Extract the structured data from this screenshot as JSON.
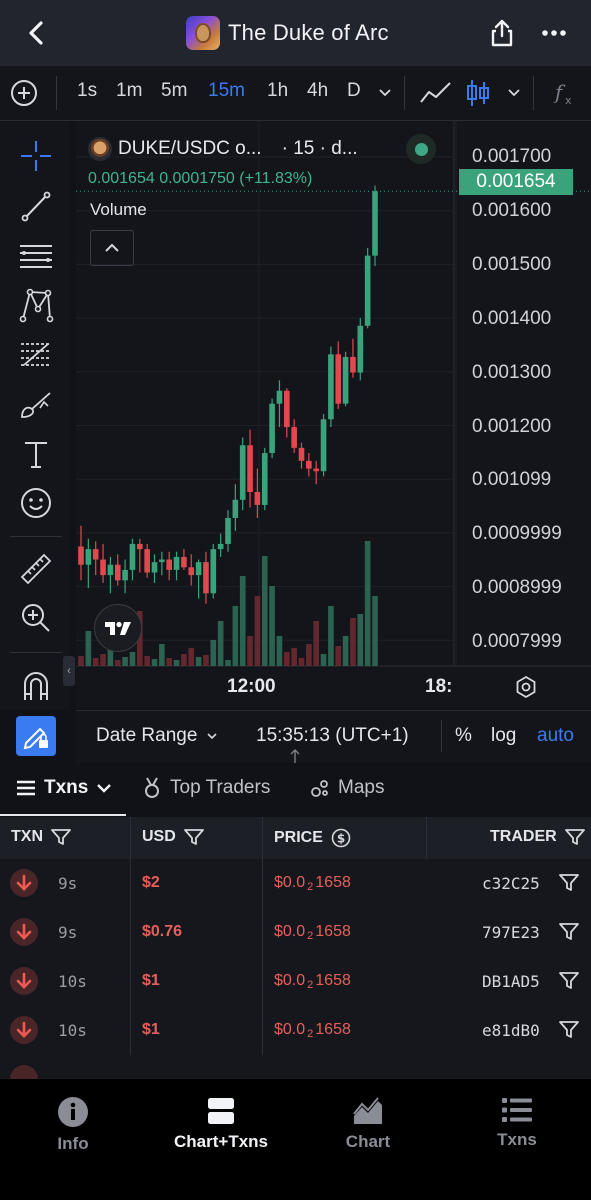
{
  "header": {
    "title": "The Duke of Arc"
  },
  "timeframes": [
    {
      "label": "1s",
      "active": false
    },
    {
      "label": "1m",
      "active": false
    },
    {
      "label": "5m",
      "active": false
    },
    {
      "label": "15m",
      "active": true
    },
    {
      "label": "1h",
      "active": false
    },
    {
      "label": "4h",
      "active": false
    },
    {
      "label": "D",
      "active": false
    }
  ],
  "chart": {
    "pair_label": "DUKE/USDC o...",
    "interval_label": "· 15 · d...",
    "ohlc": {
      "price": "0.001654",
      "change": "0.0001750",
      "change_pct": "(+11.83%)"
    },
    "volume_label": "Volume",
    "current_price": "0.001654",
    "y_ticks": [
      "0.001700",
      "0.001600",
      "0.001500",
      "0.001400",
      "0.001300",
      "0.001200",
      "0.001099",
      "0.0009999",
      "0.0008999",
      "0.0007999"
    ],
    "x_ticks": [
      "12:00",
      "18:"
    ],
    "bottom": {
      "date_range": "Date Range",
      "clock": "15:35:13 (UTC+1)",
      "pct": "%",
      "log": "log",
      "auto": "auto"
    }
  },
  "chart_data": {
    "type": "candlestick",
    "title": "DUKE/USDC · 15",
    "ylim": [
      0.00074,
      0.00177
    ],
    "up_color": "#3aa37c",
    "down_color": "#e0494f",
    "candles": [
      {
        "o": 0.00097,
        "h": 0.00101,
        "l": 0.000905,
        "c": 0.000935
      },
      {
        "o": 0.000935,
        "h": 0.000985,
        "l": 0.00089,
        "c": 0.000965
      },
      {
        "o": 0.000965,
        "h": 0.00098,
        "l": 0.000915,
        "c": 0.000945
      },
      {
        "o": 0.000945,
        "h": 0.000975,
        "l": 0.0009,
        "c": 0.000915
      },
      {
        "o": 0.000915,
        "h": 0.00095,
        "l": 0.00088,
        "c": 0.000935
      },
      {
        "o": 0.000935,
        "h": 0.000955,
        "l": 0.000895,
        "c": 0.000905
      },
      {
        "o": 0.000905,
        "h": 0.000945,
        "l": 0.00088,
        "c": 0.000925
      },
      {
        "o": 0.000925,
        "h": 0.000985,
        "l": 0.000905,
        "c": 0.000975
      },
      {
        "o": 0.000975,
        "h": 0.000985,
        "l": 0.00092,
        "c": 0.000965
      },
      {
        "o": 0.000965,
        "h": 0.000975,
        "l": 0.00091,
        "c": 0.00092
      },
      {
        "o": 0.00092,
        "h": 0.000955,
        "l": 0.0009,
        "c": 0.00094
      },
      {
        "o": 0.00094,
        "h": 0.00096,
        "l": 0.000915,
        "c": 0.000945
      },
      {
        "o": 0.000945,
        "h": 0.00096,
        "l": 0.000905,
        "c": 0.000925
      },
      {
        "o": 0.000925,
        "h": 0.00096,
        "l": 0.000905,
        "c": 0.00095
      },
      {
        "o": 0.00095,
        "h": 0.000965,
        "l": 0.000925,
        "c": 0.00093
      },
      {
        "o": 0.00093,
        "h": 0.000955,
        "l": 0.000895,
        "c": 0.000915
      },
      {
        "o": 0.000915,
        "h": 0.000945,
        "l": 0.00087,
        "c": 0.00094
      },
      {
        "o": 0.00094,
        "h": 0.00096,
        "l": 0.00086,
        "c": 0.00088
      },
      {
        "o": 0.00088,
        "h": 0.000975,
        "l": 0.00087,
        "c": 0.000965
      },
      {
        "o": 0.000965,
        "h": 0.000995,
        "l": 0.00095,
        "c": 0.000975
      },
      {
        "o": 0.000975,
        "h": 0.00104,
        "l": 0.00096,
        "c": 0.001025
      },
      {
        "o": 0.001025,
        "h": 0.00109,
        "l": 0.001,
        "c": 0.00106
      },
      {
        "o": 0.00106,
        "h": 0.00118,
        "l": 0.00104,
        "c": 0.001165
      },
      {
        "o": 0.001165,
        "h": 0.001195,
        "l": 0.001045,
        "c": 0.001075
      },
      {
        "o": 0.001075,
        "h": 0.00112,
        "l": 0.001025,
        "c": 0.00105
      },
      {
        "o": 0.00105,
        "h": 0.00116,
        "l": 0.00104,
        "c": 0.00115
      },
      {
        "o": 0.00115,
        "h": 0.001255,
        "l": 0.00114,
        "c": 0.001245
      },
      {
        "o": 0.001245,
        "h": 0.00129,
        "l": 0.0012,
        "c": 0.00127
      },
      {
        "o": 0.00127,
        "h": 0.001275,
        "l": 0.00118,
        "c": 0.0012
      },
      {
        "o": 0.0012,
        "h": 0.001215,
        "l": 0.00115,
        "c": 0.00116
      },
      {
        "o": 0.00116,
        "h": 0.00117,
        "l": 0.00112,
        "c": 0.001135
      },
      {
        "o": 0.001135,
        "h": 0.00115,
        "l": 0.001105,
        "c": 0.00112
      },
      {
        "o": 0.00112,
        "h": 0.001135,
        "l": 0.00109,
        "c": 0.001115
      },
      {
        "o": 0.001115,
        "h": 0.001225,
        "l": 0.001105,
        "c": 0.001215
      },
      {
        "o": 0.001215,
        "h": 0.001355,
        "l": 0.0012,
        "c": 0.00134
      },
      {
        "o": 0.00134,
        "h": 0.001365,
        "l": 0.001235,
        "c": 0.001245
      },
      {
        "o": 0.001245,
        "h": 0.001345,
        "l": 0.00124,
        "c": 0.001335
      },
      {
        "o": 0.001335,
        "h": 0.00137,
        "l": 0.001295,
        "c": 0.001305
      },
      {
        "o": 0.001305,
        "h": 0.00141,
        "l": 0.00129,
        "c": 0.001395
      },
      {
        "o": 0.001395,
        "h": 0.001545,
        "l": 0.00139,
        "c": 0.00153
      },
      {
        "o": 0.00153,
        "h": 0.001665,
        "l": 0.00151,
        "c": 0.001654
      }
    ],
    "volumes": [
      10,
      35,
      8,
      12,
      20,
      6,
      9,
      14,
      55,
      10,
      7,
      22,
      8,
      6,
      12,
      18,
      9,
      11,
      26,
      45,
      6,
      60,
      90,
      30,
      70,
      110,
      80,
      30,
      14,
      18,
      8,
      22,
      45,
      12,
      60,
      20,
      30,
      48,
      52,
      125,
      70
    ],
    "volume_max": 130,
    "x_tick_labels": [
      "12:00",
      "18:"
    ]
  },
  "tabs": {
    "txns": "Txns",
    "top_traders": "Top Traders",
    "maps": "Maps"
  },
  "table": {
    "headers": {
      "txn": "TXN",
      "usd": "USD",
      "price": "PRICE",
      "trader": "TRADER"
    },
    "rows": [
      {
        "age": "9s",
        "usd": "$2",
        "price_pre": "$0.0",
        "price_sub": "2",
        "price_post": "1658",
        "trader": "c32C25"
      },
      {
        "age": "9s",
        "usd": "$0.76",
        "price_pre": "$0.0",
        "price_sub": "2",
        "price_post": "1658",
        "trader": "797E23"
      },
      {
        "age": "10s",
        "usd": "$1",
        "price_pre": "$0.0",
        "price_sub": "2",
        "price_post": "1658",
        "trader": "DB1AD5"
      },
      {
        "age": "10s",
        "usd": "$1",
        "price_pre": "$0.0",
        "price_sub": "2",
        "price_post": "1658",
        "trader": "e81dB0"
      }
    ]
  },
  "nav": {
    "info": "Info",
    "chart_txns": "Chart+Txns",
    "chart": "Chart",
    "txns": "Txns"
  }
}
